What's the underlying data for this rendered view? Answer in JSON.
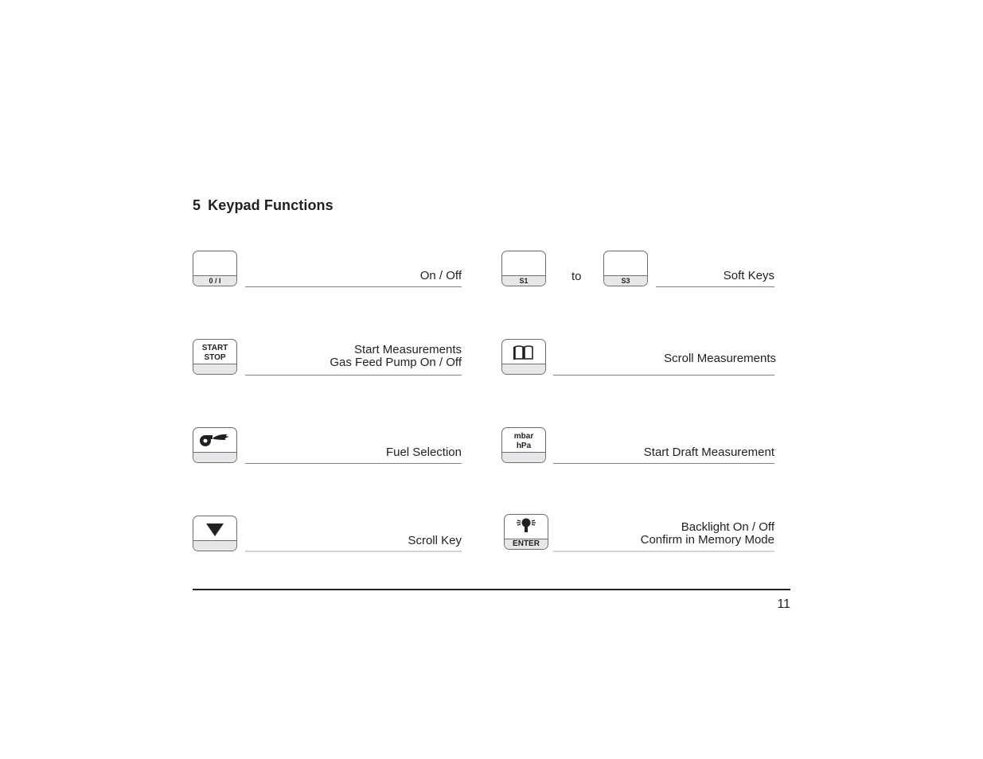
{
  "section": {
    "number": "5",
    "title": "Keypad Functions"
  },
  "keys": {
    "on_off": {
      "label": "0 / I",
      "description": "On / Off"
    },
    "soft_keys": {
      "first_label": "S1",
      "connector": "to",
      "last_label": "S3",
      "description": "Soft Keys"
    },
    "start_stop": {
      "line1": "START",
      "line2": "STOP",
      "description_line1": "Start  Measurements",
      "description_line2": "Gas Feed Pump On / Off"
    },
    "scroll_measurements": {
      "icon": "book-icon",
      "description": "Scroll Measurements"
    },
    "fuel_selection": {
      "icon": "burner-flame-icon",
      "description": "Fuel Selection"
    },
    "draft": {
      "line1": "mbar",
      "line2": "hPa",
      "description": "Start Draft Measurement"
    },
    "scroll_key": {
      "icon": "triangle-down-icon",
      "description": "Scroll Key"
    },
    "enter": {
      "icon": "light-bulb-icon",
      "label": "ENTER",
      "description_line1": "Backlight On / Off",
      "description_line2": "Confirm in Memory Mode"
    }
  },
  "footer": {
    "page_number": "11"
  }
}
